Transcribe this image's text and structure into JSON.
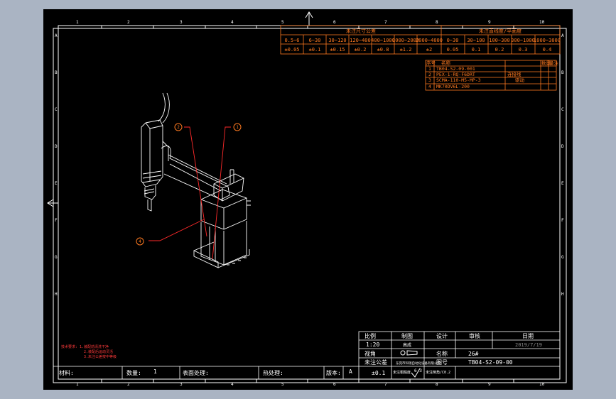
{
  "colors": {
    "background": "#aab4c3",
    "canvas": "#000000",
    "frame": "#ffffff",
    "table": "#ff7a20",
    "arm": "#ffffff",
    "callout_line": "#ff2a2a",
    "note_text": "#ff3a3a"
  },
  "frame": {
    "col_numbers": [
      "1",
      "2",
      "3",
      "4",
      "5",
      "6",
      "7",
      "8",
      "9",
      "10"
    ],
    "row_letters": [
      "A",
      "B",
      "C",
      "D",
      "E",
      "F",
      "G",
      "H"
    ]
  },
  "tolerance_table": {
    "title_left": "未注尺寸公差",
    "title_right": "未注直线度/平面度",
    "ranges_left": [
      "0.5~6",
      "6~30",
      "30~120",
      "120~400",
      "400~1000",
      "1000~2000",
      "2000~4000"
    ],
    "values_left": [
      "±0.05",
      "±0.1",
      "±0.15",
      "±0.2",
      "±0.8",
      "±1.2",
      "±2"
    ],
    "ranges_right": [
      "0~30",
      "30~100",
      "100~300",
      "300~1000",
      "1000~3000"
    ],
    "values_right": [
      "0.05",
      "0.1",
      "0.2",
      "0.3",
      "0.4"
    ]
  },
  "parts_list": {
    "headers": [
      "序号",
      "名称",
      "数量",
      "备注"
    ],
    "rows": [
      {
        "no": "1",
        "code": "TB04-S2-09-001",
        "note": ""
      },
      {
        "no": "2",
        "code": "PEX-1-RQ-F6DRT",
        "note": "连接线"
      },
      {
        "no": "3",
        "code": "SCMA-110-M5-MP-3",
        "note": "驱动"
      },
      {
        "no": "4",
        "code": "MK70DV6L-200",
        "note": ""
      }
    ]
  },
  "callouts": [
    "1",
    "2",
    "4"
  ],
  "notes": {
    "line1": "技术要求: 1.装配前清洗干净",
    "line2": "2.装配后运动灵活",
    "line3": "3.未注公差按中等级"
  },
  "title_block": {
    "labels": {
      "scale": "比例",
      "draw": "制图",
      "design": "设计",
      "check": "审核",
      "date": "日期",
      "view": "视角",
      "name": "名称",
      "drawing_no": "图号",
      "tolerance": "未注公差",
      "roughness": "未注粗糙度",
      "note": "未注倒角/C0.2"
    },
    "values": {
      "scale": "1:20",
      "date": "2019/7/19",
      "name": "26#",
      "drawing_no": "TB04-S2-09-00",
      "tolerance": "±0.1",
      "roughness": "6.3",
      "designer": "高成",
      "company": "东莞市科瑞自动化设备有限公司"
    },
    "bottom": {
      "material": "材料:",
      "quantity": "数量:",
      "qty_value": "1",
      "surface": "表面处理:",
      "heat": "热处理:",
      "version": "版本:",
      "version_value": "A"
    }
  }
}
